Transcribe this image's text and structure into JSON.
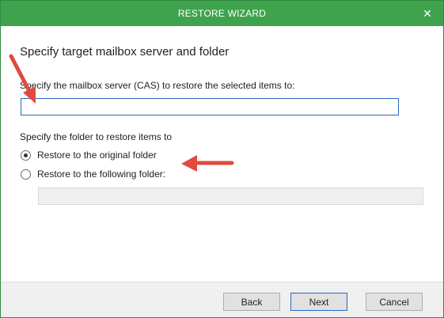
{
  "window": {
    "title": "RESTORE WIZARD",
    "close_glyph": "✕"
  },
  "main": {
    "heading": "Specify target mailbox server and folder",
    "server_label": "Specify the mailbox server (CAS) to restore the selected items to:",
    "server_value": "",
    "folder_label": "Specify the folder to restore items to",
    "options": [
      {
        "label": "Restore to the original folder",
        "selected": true
      },
      {
        "label": "Restore to the following folder:",
        "selected": false
      }
    ],
    "folder_value": ""
  },
  "footer": {
    "back_label": "Back",
    "next_label": "Next",
    "cancel_label": "Cancel"
  },
  "colors": {
    "titlebar": "#3fa34d",
    "annotation_arrow": "#e04a3f",
    "focus_border": "#2b66c4"
  }
}
